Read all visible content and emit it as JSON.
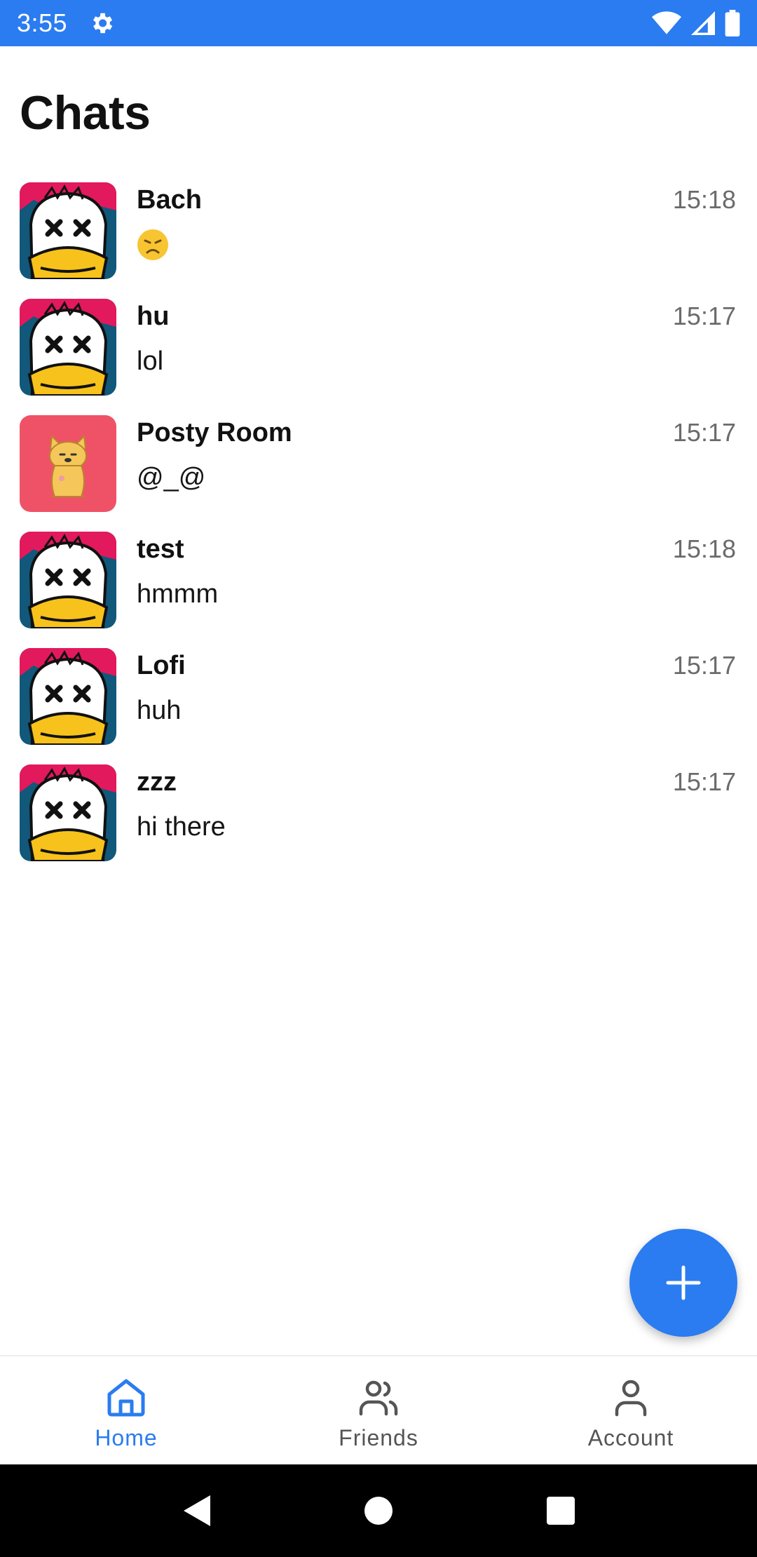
{
  "status_bar": {
    "time": "3:55",
    "icons": [
      "gear-icon",
      "wifi-icon",
      "cellular-signal-icon",
      "battery-icon"
    ],
    "color": "#2a7cf0"
  },
  "header": {
    "title": "Chats"
  },
  "chats": [
    {
      "name": "Bach",
      "time": "15:18",
      "message": "😞",
      "avatar": "duck-avatar",
      "message_type": "emoji"
    },
    {
      "name": "hu",
      "time": "15:17",
      "message": "lol",
      "avatar": "duck-avatar",
      "message_type": "text"
    },
    {
      "name": "Posty Room",
      "time": "15:17",
      "message": "@_@",
      "avatar": "dog-avatar",
      "message_type": "text"
    },
    {
      "name": "test",
      "time": "15:18",
      "message": "hmmm",
      "avatar": "duck-avatar",
      "message_type": "text"
    },
    {
      "name": "Lofi",
      "time": "15:17",
      "message": "huh",
      "avatar": "duck-avatar",
      "message_type": "text"
    },
    {
      "name": "zzz",
      "time": "15:17",
      "message": "hi there",
      "avatar": "duck-avatar",
      "message_type": "text"
    }
  ],
  "fab": {
    "icon": "plus-icon",
    "color": "#2a7cf0"
  },
  "bottom_nav": {
    "items": [
      {
        "label": "Home",
        "icon": "home-icon",
        "active": true
      },
      {
        "label": "Friends",
        "icon": "friends-icon",
        "active": false
      },
      {
        "label": "Account",
        "icon": "account-icon",
        "active": false
      }
    ],
    "active_color": "#2a7cf0"
  },
  "system_nav": {
    "icons": [
      "back-icon",
      "home-circle-icon",
      "recents-icon"
    ]
  }
}
